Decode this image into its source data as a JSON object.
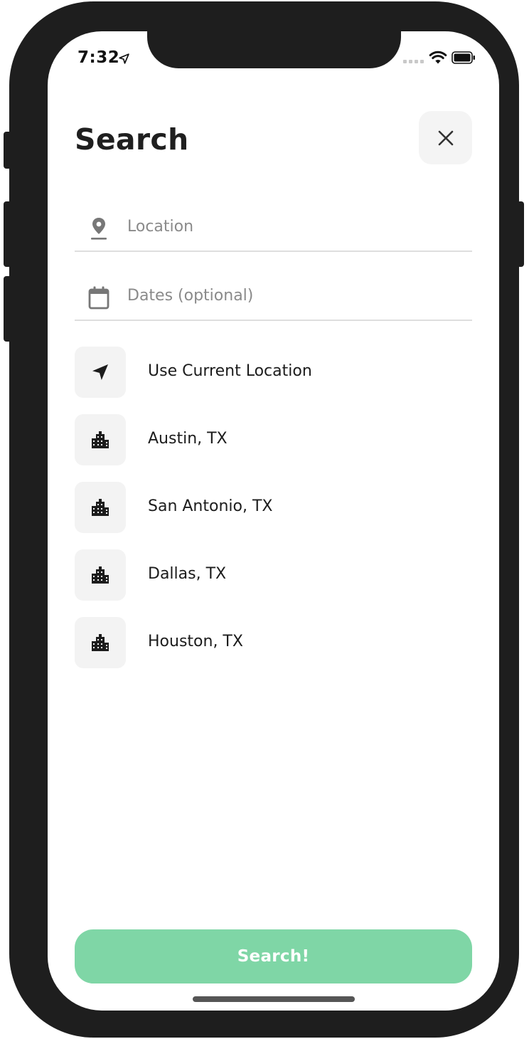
{
  "status_bar": {
    "time": "7:32"
  },
  "header": {
    "title": "Search"
  },
  "inputs": {
    "location": {
      "value": "",
      "placeholder": "Location"
    },
    "dates": {
      "value": "",
      "placeholder": "Dates (optional)"
    }
  },
  "suggestions": [
    {
      "label": "Use Current Location",
      "icon": "navigation-arrow-icon"
    },
    {
      "label": "Austin, TX",
      "icon": "city-icon"
    },
    {
      "label": "San Antonio, TX",
      "icon": "city-icon"
    },
    {
      "label": "Dallas, TX",
      "icon": "city-icon"
    },
    {
      "label": "Houston, TX",
      "icon": "city-icon"
    }
  ],
  "actions": {
    "search_label": "Search!"
  },
  "colors": {
    "accent": "#7fd6a6",
    "tile_background": "#f3f3f3",
    "frame": "#1e1e1e"
  }
}
